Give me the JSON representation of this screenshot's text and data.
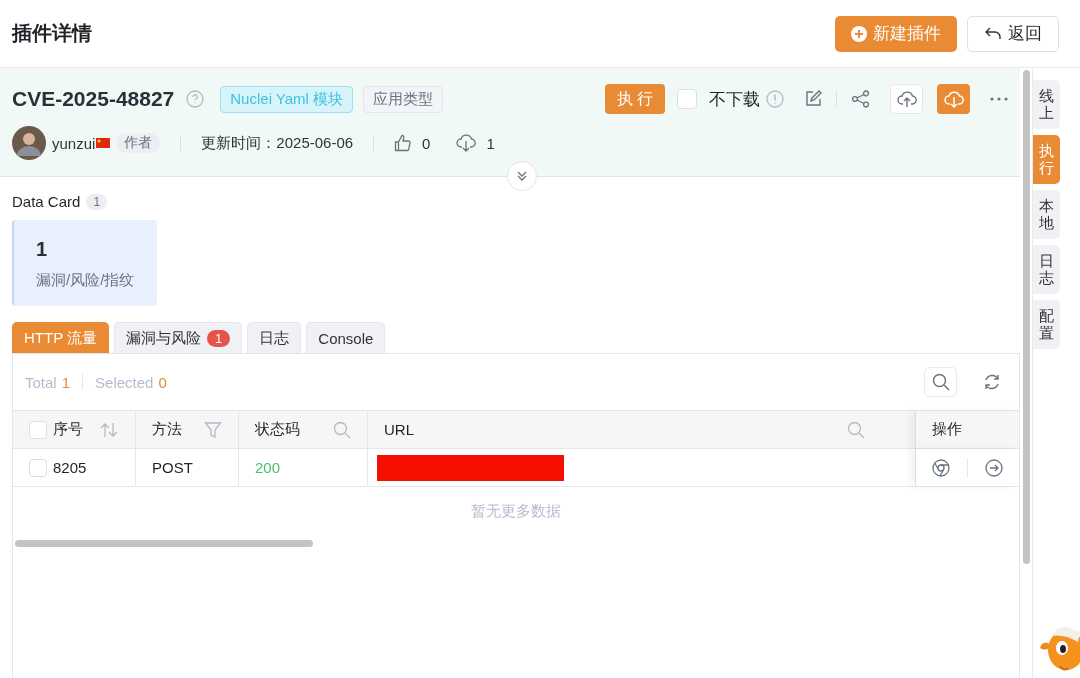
{
  "page_title": "插件详情",
  "header_buttons": [
    {
      "label": "新建插件",
      "kind": "primary"
    },
    {
      "label": "返回",
      "kind": "back"
    }
  ],
  "plugin": {
    "name": "CVE-2025-48827",
    "tags": [
      {
        "label": "Nuclei Yaml 模块",
        "kind": "module"
      },
      {
        "label": "应用类型",
        "kind": "type"
      }
    ],
    "author": "yunzui",
    "author_role": "作者",
    "updated": "更新时间：2025-06-06",
    "likes": "0",
    "downloads": "1"
  },
  "actions": {
    "run": "执 行",
    "no_download": {
      "label": "不下载",
      "checked": false
    }
  },
  "data_card": {
    "title": "Data Card",
    "count": "1",
    "value": "1",
    "label": "漏洞/风险/指纹"
  },
  "tabs": [
    {
      "label": "HTTP 流量",
      "selected": true
    },
    {
      "label": "漏洞与风险",
      "badge": "1",
      "selected": false
    },
    {
      "label": "日志",
      "selected": false
    },
    {
      "label": "Console",
      "selected": false
    }
  ],
  "summary": {
    "total_label": "Total",
    "total": "1",
    "selected_label": "Selected",
    "selected": "0"
  },
  "table": {
    "columns": [
      {
        "label": "序号",
        "kind": "sort"
      },
      {
        "label": "方法",
        "kind": "filter"
      },
      {
        "label": "状态码",
        "kind": "search"
      },
      {
        "label": "URL",
        "kind": "search"
      },
      {
        "label": "操作",
        "kind": "plain"
      }
    ],
    "select_all": false,
    "rows": [
      {
        "id": "8205",
        "method": "POST",
        "status": "200",
        "checked": false
      }
    ],
    "empty_text": "暂无更多数据"
  },
  "side_tabs": [
    {
      "label": "线上",
      "selected": false
    },
    {
      "label": "执行",
      "selected": true
    },
    {
      "label": "本地",
      "selected": false
    },
    {
      "label": "日志",
      "selected": false
    },
    {
      "label": "配置",
      "selected": false
    }
  ]
}
